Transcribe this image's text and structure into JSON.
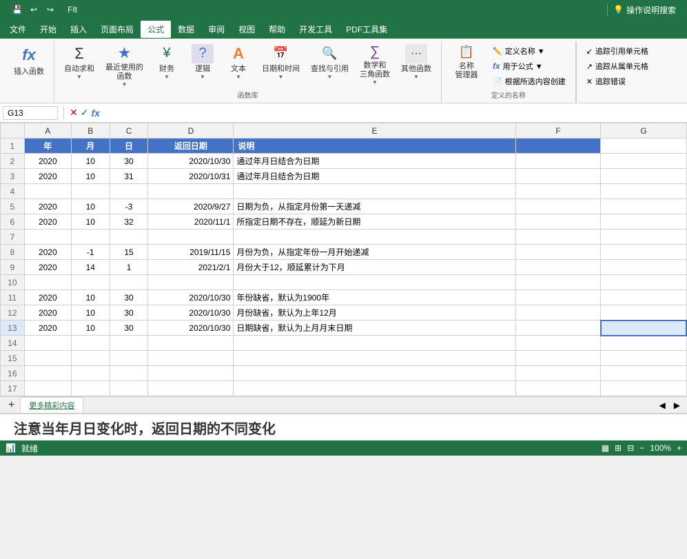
{
  "titlebar": {
    "title": "FIt",
    "quickaccess": [
      "save",
      "undo",
      "redo"
    ]
  },
  "menubar": {
    "items": [
      "文件",
      "开始",
      "插入",
      "页面布局",
      "公式",
      "数据",
      "审阅",
      "视图",
      "帮助",
      "开发工具",
      "PDF工具集"
    ],
    "active": "公式"
  },
  "ribbon": {
    "groups": [
      {
        "label": "",
        "buttons": [
          {
            "id": "insert-function",
            "label": "插入函数",
            "icon": "fx"
          }
        ]
      },
      {
        "label": "",
        "buttons": [
          {
            "id": "autosum",
            "label": "自动求和",
            "icon": "Σ"
          },
          {
            "id": "recently-used",
            "label": "最近使用的\n函数",
            "icon": "★"
          },
          {
            "id": "finance",
            "label": "财务",
            "icon": "💰"
          },
          {
            "id": "logic",
            "label": "逻辑",
            "icon": "?"
          },
          {
            "id": "text",
            "label": "文本",
            "icon": "A"
          },
          {
            "id": "datetime",
            "label": "日期和时间",
            "icon": "📅"
          },
          {
            "id": "lookup",
            "label": "查找与引用",
            "icon": "🔍"
          },
          {
            "id": "math-trig",
            "label": "数学和\n三角函数",
            "icon": "∑"
          },
          {
            "id": "other-functions",
            "label": "其他函数",
            "icon": "..."
          }
        ],
        "grouplabel": "函数库"
      }
    ],
    "definednames": {
      "label": "定义的名称",
      "buttons": [
        {
          "id": "name-manager",
          "label": "名称\n管理器",
          "icon": "📋"
        },
        {
          "id": "define-name",
          "label": "定义名称",
          "icon": "✏️"
        },
        {
          "id": "use-in-formula",
          "label": "用于公式",
          "icon": "fx"
        },
        {
          "id": "create-from-selection",
          "label": "根据所选内容创建",
          "icon": "📄"
        }
      ]
    },
    "right_buttons": [
      {
        "id": "trace-precedents",
        "label": "追踪引用单元格",
        "icon": "←"
      },
      {
        "id": "trace-dependents",
        "label": "追踪从属单元格",
        "icon": "→"
      },
      {
        "id": "trace-errors",
        "label": "追踪错误",
        "icon": "↔"
      }
    ]
  },
  "formulabar": {
    "cellref": "G13",
    "formula": ""
  },
  "help_search": "操作说明搜索",
  "spreadsheet": {
    "columns": [
      "A",
      "B",
      "C",
      "D",
      "E",
      "F",
      "G"
    ],
    "row_numbers": [
      1,
      2,
      3,
      4,
      5,
      6,
      7,
      8,
      9,
      10,
      11,
      12,
      13,
      14,
      15,
      16,
      17
    ],
    "header_row": {
      "A": "年",
      "B": "月",
      "C": "日",
      "D": "返回日期",
      "E": "说明",
      "F": "",
      "G": ""
    },
    "rows": [
      {
        "row": 2,
        "A": "2020",
        "B": "10",
        "C": "30",
        "D": "2020/10/30",
        "E": "通过年月日结合为日期",
        "F": "",
        "G": ""
      },
      {
        "row": 3,
        "A": "2020",
        "B": "10",
        "C": "31",
        "D": "2020/10/31",
        "E": "通过年月日结合为日期",
        "F": "",
        "G": ""
      },
      {
        "row": 4,
        "A": "",
        "B": "",
        "C": "",
        "D": "",
        "E": "",
        "F": "",
        "G": ""
      },
      {
        "row": 5,
        "A": "2020",
        "B": "10",
        "C": "-3",
        "D": "2020/9/27",
        "E": "日期为负，从指定月份第一天递减",
        "F": "",
        "G": ""
      },
      {
        "row": 6,
        "A": "2020",
        "B": "10",
        "C": "32",
        "D": "2020/11/1",
        "E": "所指定日期不存在，顺延为新日期",
        "F": "",
        "G": ""
      },
      {
        "row": 7,
        "A": "",
        "B": "",
        "C": "",
        "D": "",
        "E": "",
        "F": "",
        "G": ""
      },
      {
        "row": 8,
        "A": "2020",
        "B": "-1",
        "C": "15",
        "D": "2019/11/15",
        "E": "月份为负，从指定年份一月开始递减",
        "F": "",
        "G": ""
      },
      {
        "row": 9,
        "A": "2020",
        "B": "14",
        "C": "1",
        "D": "2021/2/1",
        "E": "月份大于12，顺延累计为下月",
        "F": "",
        "G": ""
      },
      {
        "row": 10,
        "A": "",
        "B": "",
        "C": "",
        "D": "",
        "E": "",
        "F": "",
        "G": ""
      },
      {
        "row": 11,
        "A": "2020",
        "B": "10",
        "C": "30",
        "D": "2020/10/30",
        "E": "年份缺省，默认为1900年",
        "F": "",
        "G": ""
      },
      {
        "row": 12,
        "A": "2020",
        "B": "10",
        "C": "30",
        "D": "2020/10/30",
        "E": "月份缺省，默认为上年12月",
        "F": "",
        "G": ""
      },
      {
        "row": 13,
        "A": "2020",
        "B": "10",
        "C": "30",
        "D": "2020/10/30",
        "E": "日期缺省，默认为上月月末日期",
        "F": "",
        "G": ""
      },
      {
        "row": 14,
        "A": "",
        "B": "",
        "C": "",
        "D": "",
        "E": "",
        "F": "",
        "G": ""
      },
      {
        "row": 15,
        "A": "",
        "B": "",
        "C": "",
        "D": "",
        "E": "",
        "F": "",
        "G": ""
      },
      {
        "row": 16,
        "A": "",
        "B": "",
        "C": "",
        "D": "",
        "E": "",
        "F": "",
        "G": ""
      },
      {
        "row": 17,
        "A": "",
        "B": "",
        "C": "",
        "D": "",
        "E": "",
        "F": "",
        "G": ""
      }
    ]
  },
  "sheet_tab": "更多精彩内容",
  "status": {
    "left": "就绪",
    "right": ""
  },
  "bottom_annotation": "注意当年月日变化时，返回日期的不同变化"
}
